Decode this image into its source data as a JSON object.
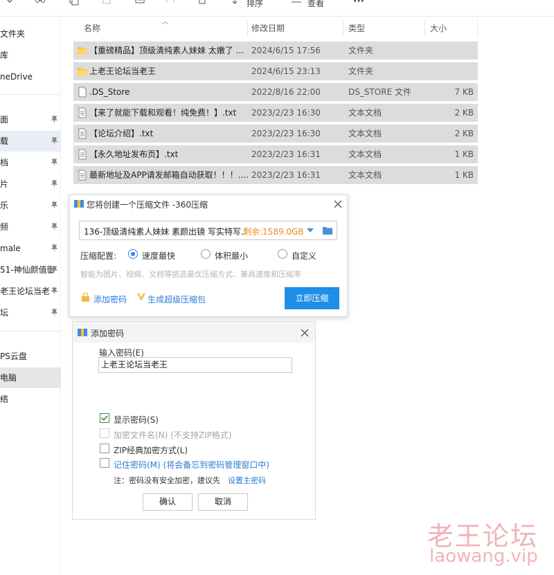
{
  "toolbar": {
    "sort_label": "排序",
    "view_label": "查看",
    "more_label": "···"
  },
  "sidebar": {
    "items": [
      {
        "label": "文件夹"
      },
      {
        "label": "库"
      },
      {
        "label": "neDrive"
      },
      {
        "label": "面"
      },
      {
        "label": "载"
      },
      {
        "label": "档"
      },
      {
        "label": "片"
      },
      {
        "label": "乐"
      },
      {
        "label": "频"
      },
      {
        "label": "male"
      },
      {
        "label": "51-神仙颜值御"
      },
      {
        "label": "老王论坛当老"
      },
      {
        "label": "坛"
      },
      {
        "label": "PS云盘"
      },
      {
        "label": "电脑"
      },
      {
        "label": "络"
      }
    ]
  },
  "list": {
    "columns": {
      "name": "名称",
      "date": "修改日期",
      "type": "类型",
      "size": "大小"
    },
    "rows": [
      {
        "icon": "folder-icon",
        "name": "【重磅精品】顶级清纯素人妹妹 太嫩了 ...",
        "date": "2024/6/15 17:56",
        "type": "文件夹",
        "size": ""
      },
      {
        "icon": "folder-icon",
        "name": "上老王论坛当老王",
        "date": "2024/6/15 23:13",
        "type": "文件夹",
        "size": ""
      },
      {
        "icon": "file-icon",
        "name": ".DS_Store",
        "date": "2022/8/16 22:00",
        "type": "DS_STORE 文件",
        "size": "7 KB"
      },
      {
        "icon": "text-file-icon",
        "name": "【来了就能下载和观看！纯免费！】.txt",
        "date": "2023/2/23 16:30",
        "type": "文本文档",
        "size": "2 KB"
      },
      {
        "icon": "text-file-icon",
        "name": "【论坛介绍】.txt",
        "date": "2023/2/23 16:30",
        "type": "文本文档",
        "size": "2 KB"
      },
      {
        "icon": "text-file-icon",
        "name": "【永久地址发布页】.txt",
        "date": "2023/2/23 16:31",
        "type": "文本文档",
        "size": "1 KB"
      },
      {
        "icon": "text-file-icon",
        "name": "最新地址及APP请发邮箱自动获取！！！....",
        "date": "2023/2/23 16:31",
        "type": "文本文档",
        "size": "1 KB"
      }
    ]
  },
  "compress_dialog": {
    "title": "您将创建一个压缩文件 -360压缩",
    "filename": "136-顶级清纯素人妹妹 素颜出镜 写实特写.zip",
    "space_text": "剩余:1589.0GB",
    "config_label": "压缩配置:",
    "options": [
      "速度最快",
      "体积最小",
      "自定义"
    ],
    "hint": "智能为图片、视频、文档等挑选最优压缩方式、兼具速度和压缩率",
    "add_password": "添加密码",
    "super_package": "生成超级压缩包",
    "start_button": "立即压缩",
    "colors": {
      "accent": "#1e8ee8",
      "space": "#f08a24"
    }
  },
  "password_dialog": {
    "title": "添加密码",
    "input_label": "输入密码(E)",
    "password_value": "上老王论坛当老王",
    "checkboxes": {
      "show_password": "显示密码(S)",
      "encrypt_names": "加密文件名(N) (不支持ZIP格式)",
      "zip_classic": "ZIP经典加密方式(L)",
      "remember": "记住密码(M) (将会备忘到密码管理窗口中)"
    },
    "note": "注：密码没有安全加密，建议先",
    "note_link": "设置主密码",
    "ok": "确认",
    "cancel": "取消"
  },
  "watermark": {
    "line1": "老王论坛",
    "line2": "laowang.vip"
  }
}
